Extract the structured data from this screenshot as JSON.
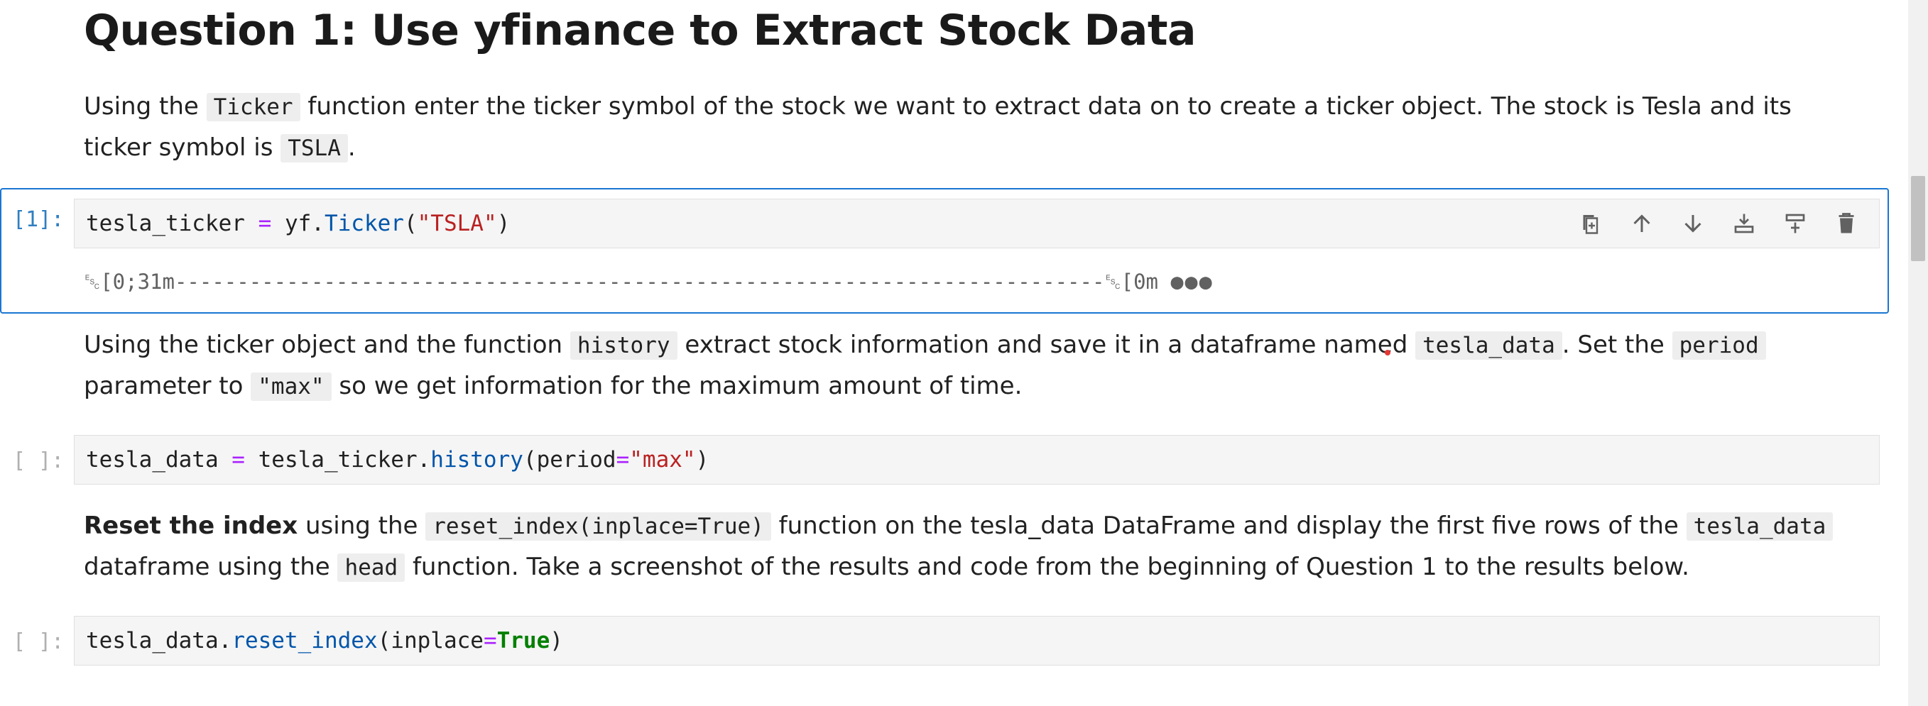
{
  "title": "Question 1: Use yfinance to Extract Stock Data",
  "para1": {
    "t1": "Using the",
    "code1": "Ticker",
    "t2": "function enter the ticker symbol of the stock we want to extract data on to create a ticker object. The stock is Tesla and its ticker symbol is",
    "code2": "TSLA",
    "t3": "."
  },
  "cell1": {
    "prompt": "[1]:",
    "code": {
      "var": "tesla_ticker",
      "op": " = ",
      "obj": "yf.",
      "fn": "Ticker",
      "open": "(",
      "str": "\"TSLA\"",
      "close": ")"
    },
    "output": "␛[0;31m---------------------------------------------------------------------------␛[0m",
    "more": "●●●"
  },
  "toolbar": {
    "items": [
      "duplicate-icon",
      "move-up-icon",
      "move-down-icon",
      "insert-below-icon",
      "insert-above-icon",
      "delete-icon"
    ]
  },
  "para2": {
    "t1": "Using the ticker object and the function",
    "code1": "history",
    "t2": "extract stock information and save it in a dataframe named",
    "code2": "tesla_data",
    "t3": ". Set the",
    "code3": "period",
    "t4": "parameter to",
    "code4": "\"max\"",
    "t5": "so we get information for the maximum amount of time."
  },
  "cell2": {
    "prompt": "[ ]:",
    "code": {
      "var": "tesla_data",
      "op": " = ",
      "obj": "tesla_ticker.",
      "fn": "history",
      "open": "(period",
      "eq": "=",
      "str": "\"max\"",
      "close": ")"
    }
  },
  "para3": {
    "bold": "Reset the index",
    "t1": "using the",
    "code1": "reset_index(inplace=True)",
    "t2": "function on the tesla_data DataFrame and display the first five rows of the",
    "code2": "tesla_data",
    "t3": "dataframe using the",
    "code3": "head",
    "t4": "function. Take a screenshot of the results and code from the beginning of Question 1 to the results below."
  },
  "cell3": {
    "prompt": "[ ]:",
    "code": {
      "obj": "tesla_data.",
      "fn": "reset_index",
      "open": "(inplace",
      "eq": "=",
      "kw": "True",
      "close": ")"
    }
  },
  "colors": {
    "accent": "#1976d2",
    "prompt_active": "#307fc1",
    "string": "#ba2121",
    "function": "#0055aa",
    "operator": "#aa22ff",
    "keyword": "#008000"
  }
}
